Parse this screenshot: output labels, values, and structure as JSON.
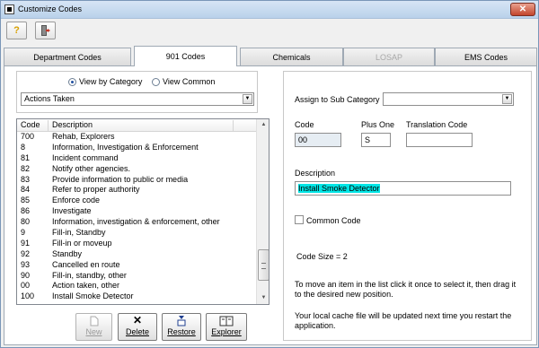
{
  "window": {
    "title": "Customize Codes",
    "close_glyph": "✕"
  },
  "toolbar": {
    "help_icon": "question-icon",
    "exit_icon": "exit-door-icon"
  },
  "tabs": [
    {
      "label": "Department Codes"
    },
    {
      "label": "901 Codes"
    },
    {
      "label": "Chemicals"
    },
    {
      "label": "LOSAP"
    },
    {
      "label": "EMS Codes"
    }
  ],
  "view": {
    "by_category_label": "View by Category",
    "common_label": "View Common",
    "selected": "by_category"
  },
  "category_select": {
    "value": "Actions Taken"
  },
  "list": {
    "headers": {
      "code": "Code",
      "description": "Description"
    },
    "rows": [
      {
        "code": "700",
        "description": "Rehab, Explorers"
      },
      {
        "code": "8",
        "description": "Information, Investigation & Enforcement"
      },
      {
        "code": "81",
        "description": "Incident command"
      },
      {
        "code": "82",
        "description": "Notify other agencies."
      },
      {
        "code": "83",
        "description": "Provide information to public or media"
      },
      {
        "code": "84",
        "description": "Refer to proper authority"
      },
      {
        "code": "85",
        "description": "Enforce code"
      },
      {
        "code": "86",
        "description": "Investigate"
      },
      {
        "code": "80",
        "description": "Information, investigation & enforcement, other"
      },
      {
        "code": "9",
        "description": "Fill-in, Standby"
      },
      {
        "code": "91",
        "description": "Fill-in or moveup"
      },
      {
        "code": "92",
        "description": "Standby"
      },
      {
        "code": "93",
        "description": "Cancelled en route"
      },
      {
        "code": "90",
        "description": "Fill-in, standby, other"
      },
      {
        "code": "00",
        "description": "Action taken, other"
      },
      {
        "code": "100",
        "description": "Install Smoke Detector"
      }
    ]
  },
  "buttons": {
    "new": "New",
    "delete": "Delete",
    "restore": "Restore",
    "explorer": "Explorer"
  },
  "detail": {
    "assign_label": "Assign to Sub Category",
    "assign_value": "",
    "code_label": "Code",
    "code_value": "00",
    "plus_one_label": "Plus One",
    "plus_one_value": "S",
    "translation_label": "Translation Code",
    "translation_value": "",
    "description_label": "Description",
    "description_value": "Install Smoke Detector",
    "common_code_label": "Common Code",
    "code_size": "Code Size = 2",
    "move_help": "To move an item in the list click it once to select it, then drag it to the desired new position.",
    "cache_help": "Your local cache file will be updated next time you restart the application."
  },
  "colors": {
    "highlight": "#00e5e5",
    "accent": "#3a6ea5"
  }
}
